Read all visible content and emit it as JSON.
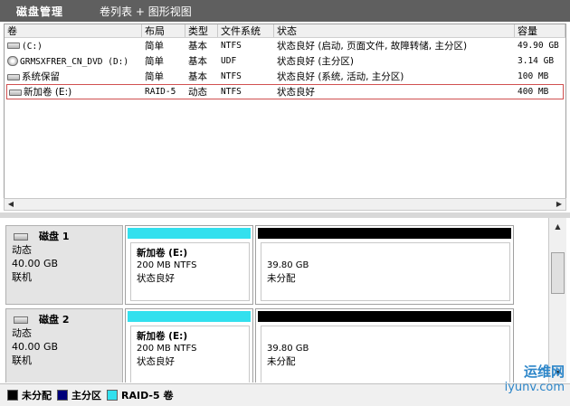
{
  "titlebar": {
    "app_title": "磁盘管理",
    "view_title": "卷列表 + 图形视图"
  },
  "columns": [
    "卷",
    "布局",
    "类型",
    "文件系统",
    "状态",
    "容量"
  ],
  "volumes": [
    {
      "name": "(C:)",
      "icon": "drive-icon",
      "layout": "简单",
      "type": "基本",
      "fs": "NTFS",
      "status": "状态良好 (启动, 页面文件, 故障转储, 主分区)",
      "capacity": "49.90 GB"
    },
    {
      "name": "GRMSXFRER_CN_DVD (D:)",
      "icon": "cd-icon",
      "layout": "简单",
      "type": "基本",
      "fs": "UDF",
      "status": "状态良好 (主分区)",
      "capacity": "3.14 GB"
    },
    {
      "name": "系统保留",
      "icon": "drive-icon",
      "layout": "简单",
      "type": "基本",
      "fs": "NTFS",
      "status": "状态良好 (系统, 活动, 主分区)",
      "capacity": "100 MB"
    },
    {
      "name": "新加卷 (E:)",
      "icon": "drive-icon",
      "layout": "RAID-5",
      "type": "动态",
      "fs": "NTFS",
      "status": "状态良好",
      "capacity": "400 MB"
    }
  ],
  "disks": [
    {
      "name": "磁盘 1",
      "type": "动态",
      "size": "40.00 GB",
      "state": "联机",
      "raid": {
        "name": "新加卷  (E:)",
        "detail": "200 MB NTFS",
        "status": "状态良好"
      },
      "unalloc": {
        "size": "39.80 GB",
        "label": "未分配"
      }
    },
    {
      "name": "磁盘 2",
      "type": "动态",
      "size": "40.00 GB",
      "state": "联机",
      "raid": {
        "name": "新加卷  (E:)",
        "detail": "200 MB NTFS",
        "status": "状态良好"
      },
      "unalloc": {
        "size": "39.80 GB",
        "label": "未分配"
      }
    }
  ],
  "legend": [
    {
      "label": "未分配",
      "color": "#000000"
    },
    {
      "label": "主分区",
      "color": "#00007a"
    },
    {
      "label": "RAID-5 卷",
      "color": "#33e0ee"
    }
  ],
  "watermark": {
    "line1": "运维网",
    "line2": "iyunv.com"
  },
  "colors": {
    "raid_bar": "#33e0ee",
    "unalloc_bar": "#000000",
    "selection": "#d05050"
  }
}
